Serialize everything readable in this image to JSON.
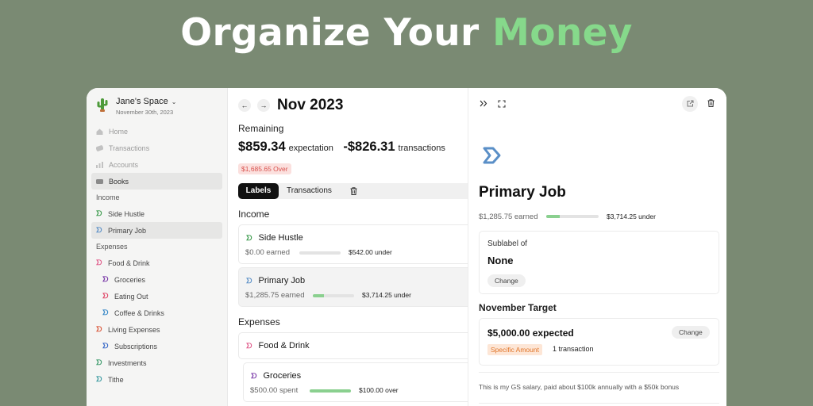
{
  "headline": {
    "prefix": "Organize Your ",
    "accent": "Money"
  },
  "sidebar": {
    "workspace_name": "Jane's Space",
    "workspace_date": "November 30th, 2023",
    "chev": "⌄",
    "nav": [
      {
        "label": "Home",
        "icon": "home-icon"
      },
      {
        "label": "Transactions",
        "icon": "transactions-icon"
      },
      {
        "label": "Accounts",
        "icon": "accounts-icon"
      },
      {
        "label": "Books",
        "icon": "books-icon"
      }
    ],
    "income_heading": "Income",
    "income": [
      {
        "label": "Side Hustle",
        "color": "#3a9a4b"
      },
      {
        "label": "Primary Job",
        "color": "#5a8fc7"
      }
    ],
    "expenses_heading": "Expenses",
    "expenses": [
      {
        "label": "Food & Drink",
        "color": "#e05a8a"
      },
      {
        "label": "Groceries",
        "color": "#7a3aa8"
      },
      {
        "label": "Eating Out",
        "color": "#e04a6a"
      },
      {
        "label": "Coffee & Drinks",
        "color": "#3a8ac7"
      },
      {
        "label": "Living Expenses",
        "color": "#d9573a"
      },
      {
        "label": "Subscriptions",
        "color": "#3a6ac7"
      },
      {
        "label": "Investments",
        "color": "#3a9a6a"
      },
      {
        "label": "Tithe",
        "color": "#3a9aa0"
      }
    ]
  },
  "main": {
    "prev": "←",
    "next": "→",
    "month": "Nov 2023",
    "remaining_label": "Remaining",
    "expectation_amount": "$859.34",
    "expectation_label": "expectation",
    "transactions_amount": "-$826.31",
    "transactions_label": "transactions",
    "over_badge": "$1,685.65 Over",
    "tabs": {
      "labels": "Labels",
      "transactions": "Transactions"
    },
    "income_heading": "Income",
    "expenses_heading": "Expenses",
    "cards": {
      "side_hustle": {
        "title": "Side Hustle",
        "earned": "$0.00 earned",
        "progress": 0,
        "status": "$542.00 under"
      },
      "primary_job": {
        "title": "Primary Job",
        "earned": "$1,285.75 earned",
        "progress": 0.26,
        "status": "$3,714.25 under"
      },
      "food_drink": {
        "title": "Food & Drink"
      },
      "groceries": {
        "title": "Groceries",
        "spent": "$500.00 spent",
        "progress": 1.0,
        "status": "$100.00 over"
      }
    }
  },
  "detail": {
    "title": "Primary Job",
    "earned": "$1,285.75 earned",
    "progress": 0.26,
    "status": "$3,714.25 under",
    "sublabel_label": "Sublabel of",
    "sublabel_value": "None",
    "change": "Change",
    "target_heading": "November Target",
    "target_amount": "$5,000.00 expected",
    "target_type": "Specific Amount",
    "target_count": "1 transaction",
    "note": "This is my GS salary, paid about $100k annually with a $50k bonus"
  }
}
